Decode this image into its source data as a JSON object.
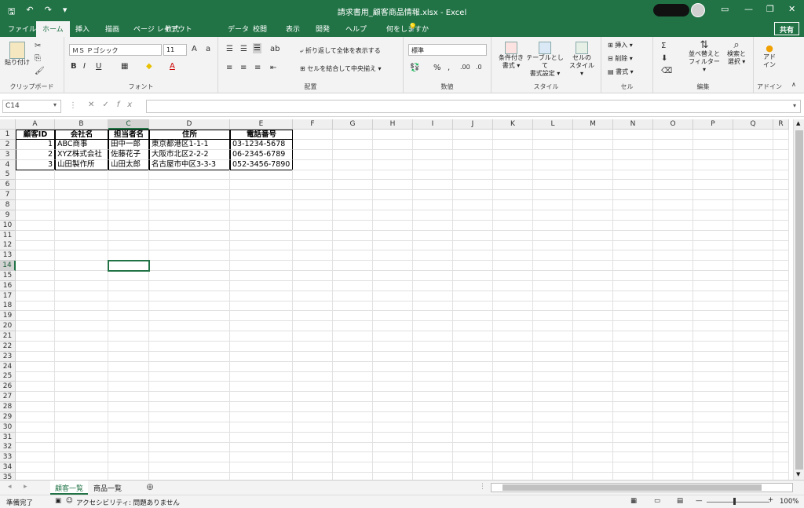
{
  "app": {
    "title": "請求書用_顧客商品情報.xlsx - Excel",
    "share_label": "共有"
  },
  "tabs": [
    "ファイル",
    "ホーム",
    "挿入",
    "描画",
    "ページ レイアウト",
    "数式",
    "データ",
    "校閲",
    "表示",
    "開発",
    "ヘルプ",
    "何をしますか"
  ],
  "active_tab": "ホーム",
  "ribbon": {
    "clipboard": {
      "paste": "貼り付け",
      "label": "クリップボード"
    },
    "font": {
      "name": "ＭＳ Ｐゴシック",
      "size": "11",
      "label": "フォント"
    },
    "align": {
      "wrap": "折り返して全体を表示する",
      "merge": "セルを結合して中央揃え",
      "label": "配置"
    },
    "number": {
      "format": "標準",
      "label": "数値"
    },
    "styles": {
      "cond_1": "条件付き",
      "cond_2": "書式 ▾",
      "table_1": "テーブルとして",
      "table_2": "書式設定 ▾",
      "cell_1": "セルの",
      "cell_2": "スタイル ▾",
      "label": "スタイル"
    },
    "cells": {
      "insert": "挿入",
      "delete": "削除",
      "format": "書式",
      "label": "セル"
    },
    "edit": {
      "sort_1": "並べ替えと",
      "sort_2": "フィルター ▾",
      "find_1": "検索と",
      "find_2": "選択 ▾",
      "label": "編集"
    },
    "addin": {
      "btn_1": "アド",
      "btn_2": "イン",
      "label": "アドイン"
    }
  },
  "formula_bar": {
    "name_box": "C14",
    "formula": ""
  },
  "columns": [
    "A",
    "B",
    "C",
    "D",
    "E",
    "F",
    "G",
    "H",
    "I",
    "J",
    "K",
    "L",
    "M",
    "N",
    "O",
    "P",
    "Q",
    "R"
  ],
  "selected_cell": "C14",
  "sheet": {
    "headers": [
      "顧客ID",
      "会社名",
      "担当者名",
      "住所",
      "電話番号"
    ],
    "rows": [
      [
        "1",
        "ABC商事",
        "田中一郎",
        "東京都港区1-1-1",
        "03-1234-5678"
      ],
      [
        "2",
        "XYZ株式会社",
        "佐藤花子",
        "大阪市北区2-2-2",
        "06-2345-6789"
      ],
      [
        "3",
        "山田製作所",
        "山田太郎",
        "名古屋市中区3-3-3",
        "052-3456-7890"
      ]
    ]
  },
  "sheet_tabs": [
    "顧客一覧",
    "商品一覧"
  ],
  "active_sheet": "顧客一覧",
  "status": {
    "ready": "準備完了",
    "accessibility": "アクセシビリティ: 問題ありません",
    "zoom": "100%"
  },
  "colors": {
    "accent": "#217346"
  }
}
